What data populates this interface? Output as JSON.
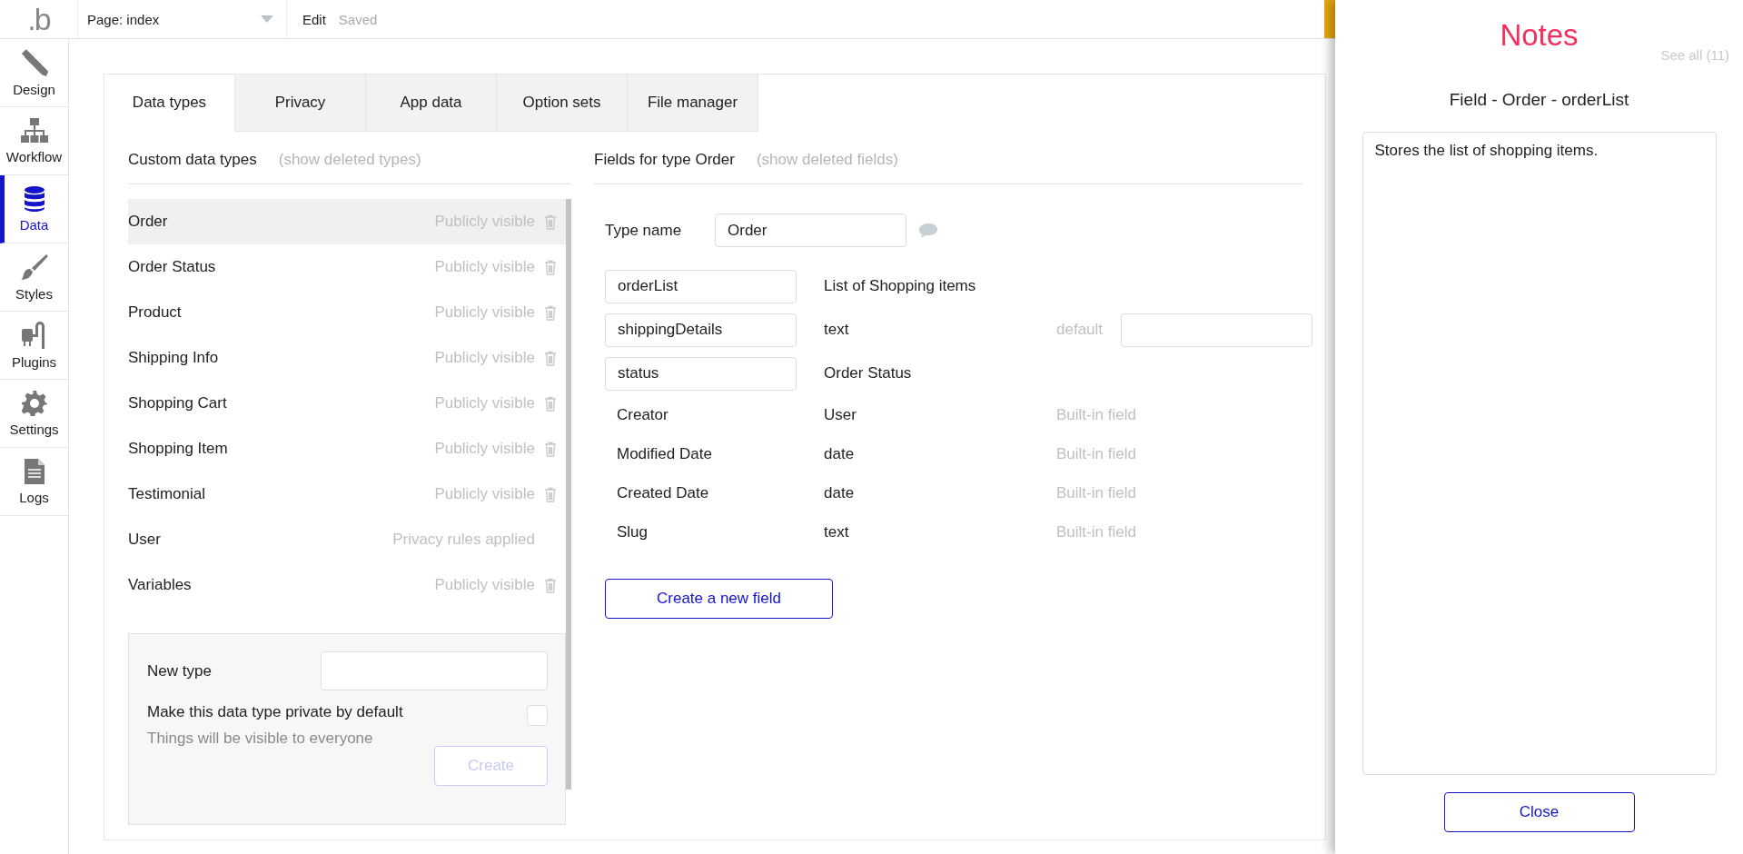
{
  "topbar": {
    "logo": ".b",
    "page_selector": "Page: index",
    "edit_label": "Edit",
    "save_status": "Saved"
  },
  "sidebar": {
    "items": [
      {
        "label": "Design",
        "selected": false
      },
      {
        "label": "Workflow",
        "selected": false
      },
      {
        "label": "Data",
        "selected": true
      },
      {
        "label": "Styles",
        "selected": false
      },
      {
        "label": "Plugins",
        "selected": false
      },
      {
        "label": "Settings",
        "selected": false
      },
      {
        "label": "Logs",
        "selected": false
      }
    ]
  },
  "tabs": [
    {
      "label": "Data types",
      "selected": true
    },
    {
      "label": "Privacy",
      "selected": false
    },
    {
      "label": "App data",
      "selected": false
    },
    {
      "label": "Option sets",
      "selected": false
    },
    {
      "label": "File manager",
      "selected": false
    }
  ],
  "custom_types": {
    "title": "Custom data types",
    "show_deleted": "(show deleted types)",
    "items": [
      {
        "name": "Order",
        "visibility": "Publicly visible",
        "deletable": true,
        "selected": true
      },
      {
        "name": "Order Status",
        "visibility": "Publicly visible",
        "deletable": true,
        "selected": false
      },
      {
        "name": "Product",
        "visibility": "Publicly visible",
        "deletable": true,
        "selected": false
      },
      {
        "name": "Shipping Info",
        "visibility": "Publicly visible",
        "deletable": true,
        "selected": false
      },
      {
        "name": "Shopping Cart",
        "visibility": "Publicly visible",
        "deletable": true,
        "selected": false
      },
      {
        "name": "Shopping Item",
        "visibility": "Publicly visible",
        "deletable": true,
        "selected": false
      },
      {
        "name": "Testimonial",
        "visibility": "Publicly visible",
        "deletable": true,
        "selected": false
      },
      {
        "name": "User",
        "visibility": "Privacy rules applied",
        "deletable": false,
        "selected": false
      },
      {
        "name": "Variables",
        "visibility": "Publicly visible",
        "deletable": true,
        "selected": false
      }
    ]
  },
  "new_type": {
    "label": "New type",
    "private_label": "Make this data type private by default",
    "private_hint": "Things will be visible to everyone",
    "private_checked": false,
    "create_button": "Create",
    "create_disabled": true
  },
  "fields": {
    "title": "Fields for type Order",
    "show_deleted": "(show deleted fields)",
    "type_name_label": "Type name",
    "type_name": "Order",
    "items": [
      {
        "kind": "custom",
        "name": "orderList",
        "type": "List of Shopping items"
      },
      {
        "kind": "custom",
        "name": "shippingDetails",
        "type": "text",
        "default_label": "default"
      },
      {
        "kind": "custom",
        "name": "status",
        "type": "Order Status"
      },
      {
        "kind": "builtin",
        "name": "Creator",
        "type": "User",
        "note": "Built-in field"
      },
      {
        "kind": "builtin",
        "name": "Modified Date",
        "type": "date",
        "note": "Built-in field"
      },
      {
        "kind": "builtin",
        "name": "Created Date",
        "type": "date",
        "note": "Built-in field"
      },
      {
        "kind": "builtin",
        "name": "Slug",
        "type": "text",
        "note": "Built-in field"
      }
    ],
    "create_button": "Create a new field"
  },
  "notes": {
    "title": "Notes",
    "see_all": "See all (11)",
    "subject": "Field - Order - orderList",
    "text": "Stores the list of shopping items.",
    "close_button": "Close"
  }
}
